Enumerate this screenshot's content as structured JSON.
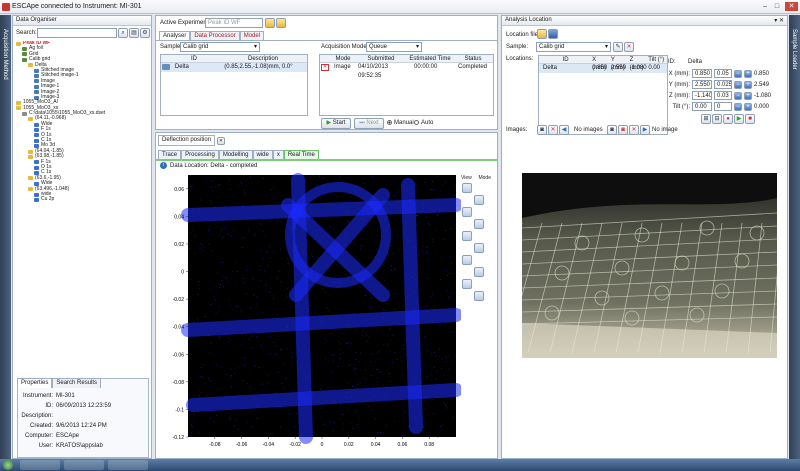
{
  "window": {
    "title": "ESCApe connected to Instrument: MI-301",
    "controls": [
      "‒",
      "□",
      "✕"
    ]
  },
  "side_tabs": {
    "left": "Acquisition Method",
    "right": "Sample Loader"
  },
  "organiser": {
    "header": "Data Organiser",
    "search_label": "Search:",
    "tree": [
      {
        "label": "Peak ID WF",
        "level": 1,
        "icon": "folder",
        "color": "#d02020"
      },
      {
        "label": "Ag foil",
        "level": 2,
        "icon": "sample"
      },
      {
        "label": "Grid",
        "level": 2,
        "icon": "sample"
      },
      {
        "label": "Calib grid",
        "level": 2,
        "icon": "sample"
      },
      {
        "label": "Delta",
        "level": 3,
        "icon": "folder"
      },
      {
        "label": "Stitched image",
        "level": 4,
        "icon": "image"
      },
      {
        "label": "Stitched image-1",
        "level": 4,
        "icon": "image"
      },
      {
        "label": "Image",
        "level": 4,
        "icon": "image"
      },
      {
        "label": "Image-1",
        "level": 4,
        "icon": "image"
      },
      {
        "label": "Image-2",
        "level": 4,
        "icon": "image"
      },
      {
        "label": "Image-3",
        "level": 4,
        "icon": "image"
      },
      {
        "label": "1055_MoO3_Al",
        "level": 1,
        "icon": "folder"
      },
      {
        "label": "1055_MoO3_xs",
        "level": 1,
        "icon": "folder"
      },
      {
        "label": "C:\\data\\1055\\1055_MoO3_xs.dset",
        "level": 2,
        "icon": "dataset"
      },
      {
        "label": "(64.11,-0.968)",
        "level": 3,
        "icon": "folder"
      },
      {
        "label": "Wide",
        "level": 4,
        "icon": "spectrum"
      },
      {
        "label": "F 1s",
        "level": 4,
        "icon": "spectrum"
      },
      {
        "label": "O 1s",
        "level": 4,
        "icon": "spectrum"
      },
      {
        "label": "C 1s",
        "level": 4,
        "icon": "spectrum"
      },
      {
        "label": "Mo 3d",
        "level": 4,
        "icon": "spectrum"
      },
      {
        "label": "(64.04,-1.85)",
        "level": 3,
        "icon": "folder"
      },
      {
        "label": "(63.98,-1.85)",
        "level": 3,
        "icon": "folder"
      },
      {
        "label": "F 1s",
        "level": 4,
        "icon": "spectrum"
      },
      {
        "label": "O 1s",
        "level": 4,
        "icon": "spectrum"
      },
      {
        "label": "C 1s",
        "level": 4,
        "icon": "spectrum"
      },
      {
        "label": "(63.6,-1.95)",
        "level": 3,
        "icon": "folder"
      },
      {
        "label": "Wide",
        "level": 4,
        "icon": "spectrum"
      },
      {
        "label": "(63.496,-1.048)",
        "level": 3,
        "icon": "folder"
      },
      {
        "label": "wide",
        "level": 4,
        "icon": "spectrum"
      },
      {
        "label": "Cu 2p",
        "level": 4,
        "icon": "spectrum"
      }
    ]
  },
  "properties": {
    "tabs": [
      "Properties",
      "Search Results"
    ],
    "rows": [
      {
        "label": "Instrument:",
        "value": "MI-301"
      },
      {
        "label": "ID:",
        "value": "06/09/2013 12:23:59"
      },
      {
        "label": "Description:",
        "value": ""
      },
      {
        "label": "Created:",
        "value": "9/6/2013 12:24 PM"
      },
      {
        "label": "Computer:",
        "value": "ESCApe"
      },
      {
        "label": "User:",
        "value": "KRATOS\\appslab"
      }
    ]
  },
  "experiment": {
    "label": "Active Experiment:",
    "value": "Peak ID WF",
    "tabs": [
      "Analyser",
      "Data Processor",
      "Model"
    ],
    "sample_label": "Sample:",
    "sample_value": "Calib grid",
    "list_headers": [
      "ID",
      "Description"
    ],
    "list_rows": [
      {
        "id": "Delta",
        "desc": "(0.85,2.55,-1.08)mm, 0.0°"
      }
    ],
    "acq_label": "Acquisition Mode:",
    "acq_value": "Queue",
    "queue_headers": [
      "Mode",
      "Submitted",
      "Estimated Time",
      "Status"
    ],
    "queue_rows": [
      {
        "mode": "Image",
        "submitted": "04/10/2013 09:52:35",
        "time": "00:00:00",
        "status": "Completed"
      }
    ],
    "start": "Start",
    "next": "Next",
    "manual": "Manual",
    "auto": "Auto"
  },
  "deflection": {
    "header": "Deflection position",
    "tabs": [
      "Trace",
      "Processing",
      "Modelling",
      "wide",
      "Real Time"
    ],
    "info": "Data Location: Delta - completed",
    "tool_labels": [
      "View",
      "Mode"
    ]
  },
  "chart_data": {
    "type": "heatmap",
    "title": "",
    "xlabel": "",
    "ylabel": "",
    "xlim": [
      -0.1,
      0.1
    ],
    "ylim": [
      -0.12,
      0.07
    ],
    "x_ticks": [
      "-0.08",
      "-0.06",
      "-0.04",
      "-0.02",
      "0",
      "0.02",
      "0.04",
      "0.06",
      "0.08"
    ],
    "y_ticks": [
      "0.06",
      "0.04",
      "0.02",
      "0",
      "-0.02",
      "-0.04",
      "-0.06",
      "-0.08",
      "-0.1",
      "-0.12"
    ]
  },
  "location": {
    "header": "Analysis Location",
    "file_label": "Location file:",
    "sample_label": "Sample:",
    "sample_value": "Calib grid",
    "locations_label": "Locations:",
    "headers": [
      "ID",
      "X (mm)",
      "Y (mm)",
      "Z (mm)",
      "Tilt (°)"
    ],
    "rows": [
      {
        "id": "Delta",
        "x": "0.850",
        "y": "2.550",
        "z": "-1.080",
        "tilt": "0.00"
      }
    ],
    "id_label": "ID:",
    "id_value": "Delta",
    "coords": [
      {
        "label": "X (mm):",
        "value": "0.850",
        "step": "0.05",
        "current": "0.850"
      },
      {
        "label": "Y (mm):",
        "value": "2.550",
        "step": "0.025",
        "current": "2.549"
      },
      {
        "label": "Z (mm):",
        "value": "-1.140",
        "step": "0.03",
        "current": "-1.080"
      },
      {
        "label": "Tilt (°):",
        "value": "0.00",
        "step": "0",
        "current": "0.000"
      }
    ],
    "images_label": "Images:",
    "no_images_1": "No images",
    "no_images_2": "No image"
  },
  "taskbar": {
    "items": [
      "",
      "",
      "",
      "",
      ""
    ]
  },
  "colors": {
    "accent": "#2d6fb8",
    "plot_bg": "#000000",
    "grid_blue": "#1c2cff",
    "red": "#cc2222",
    "green": "#2e9b2e"
  }
}
